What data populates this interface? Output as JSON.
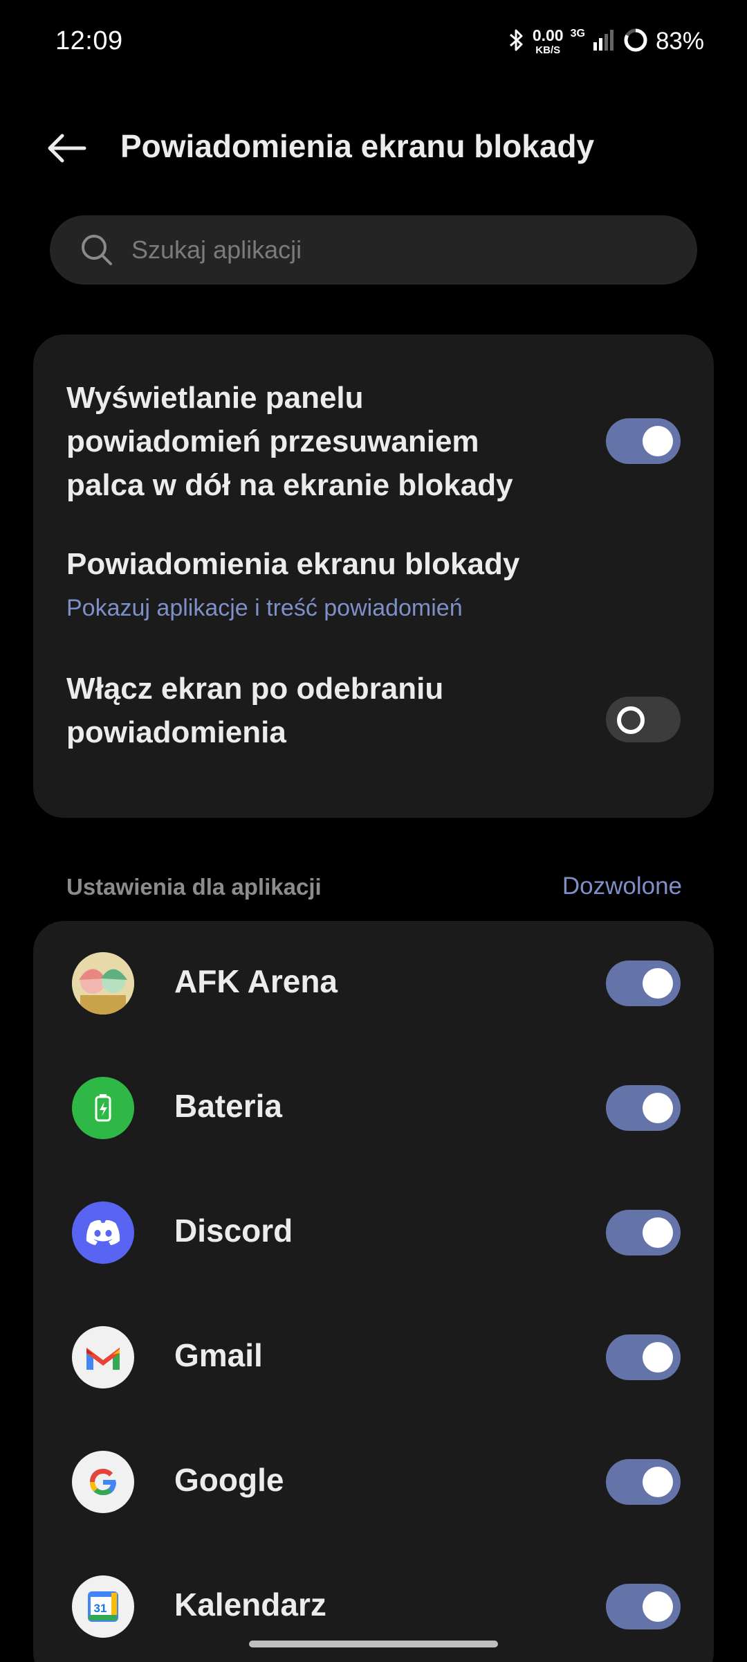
{
  "status": {
    "time": "12:09",
    "speed_value": "0.00",
    "speed_unit": "KB/S",
    "network_type": "3G",
    "battery": "83%"
  },
  "header": {
    "title": "Powiadomienia ekranu blokady",
    "back_icon": "arrow-left-icon"
  },
  "search": {
    "placeholder": "Szukaj aplikacji"
  },
  "settings": [
    {
      "label_lines": [
        "Wyświetlanie panelu",
        "powiadomień przesuwaniem",
        "palca w dół na ekranie blokady"
      ],
      "toggle": "on"
    },
    {
      "label": "Powiadomienia ekranu blokady",
      "subtitle": "Pokazuj aplikacje i treść powiadomień"
    },
    {
      "label_lines": [
        "Włącz ekran po odebraniu",
        "powiadomienia"
      ],
      "toggle": "off"
    }
  ],
  "apps_section": {
    "label": "Ustawienia dla aplikacji",
    "filter": "Dozwolone"
  },
  "apps": [
    {
      "name": "AFK Arena",
      "icon": "afk-arena-icon",
      "enabled": true
    },
    {
      "name": "Bateria",
      "icon": "battery-icon",
      "enabled": true
    },
    {
      "name": "Discord",
      "icon": "discord-icon",
      "enabled": true
    },
    {
      "name": "Gmail",
      "icon": "gmail-icon",
      "enabled": true
    },
    {
      "name": "Google",
      "icon": "google-icon",
      "enabled": true
    },
    {
      "name": "Kalendarz",
      "icon": "calendar-icon",
      "enabled": true,
      "calendar_day": "31"
    }
  ],
  "colors": {
    "background": "#000000",
    "card": "#1b1b1b",
    "accent": "#7f8fc8",
    "toggle_on": "#6474a8",
    "toggle_off": "#3c3c3c"
  }
}
